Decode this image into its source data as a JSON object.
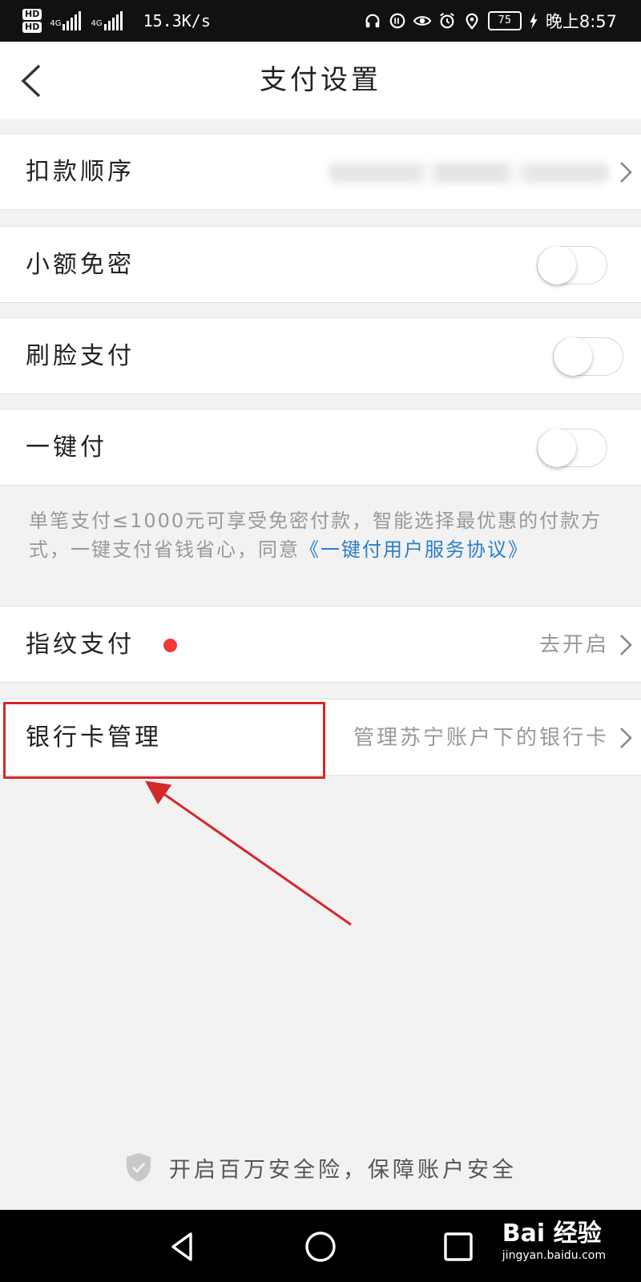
{
  "status_bar": {
    "net_speed": "15.3K/s",
    "signal1_label": "4G",
    "signal2_label": "4G",
    "hd1": "HD",
    "hd2": "HD",
    "battery": "75",
    "time": "晚上8:57"
  },
  "header": {
    "title": "支付设置"
  },
  "settings": {
    "deduct_order": {
      "label": "扣款顺序"
    },
    "small_no_password": {
      "label": "小额免密",
      "enabled": false
    },
    "face_pay": {
      "label": "刷脸支付",
      "enabled": false
    },
    "one_click_pay": {
      "label": "一键付",
      "enabled": false
    },
    "one_click_note": {
      "text": "单笔支付≤1000元可享受免密付款，智能选择最优惠的付款方式，一键支付省钱省心，同意",
      "link": "《一键付用户服务协议》"
    },
    "fingerprint_pay": {
      "label": "指纹支付",
      "value": "去开启"
    },
    "bank_card": {
      "label": "银行卡管理",
      "value": "管理苏宁账户下的银行卡"
    }
  },
  "footer": {
    "safety_text": "开启百万安全险，保障账户安全"
  },
  "watermark": {
    "main": "Bai 经验",
    "sub": "jingyan.baidu.com"
  },
  "colors": {
    "link": "#2b7fc9",
    "badge": "#f2373d",
    "annotation": "#d62828"
  }
}
